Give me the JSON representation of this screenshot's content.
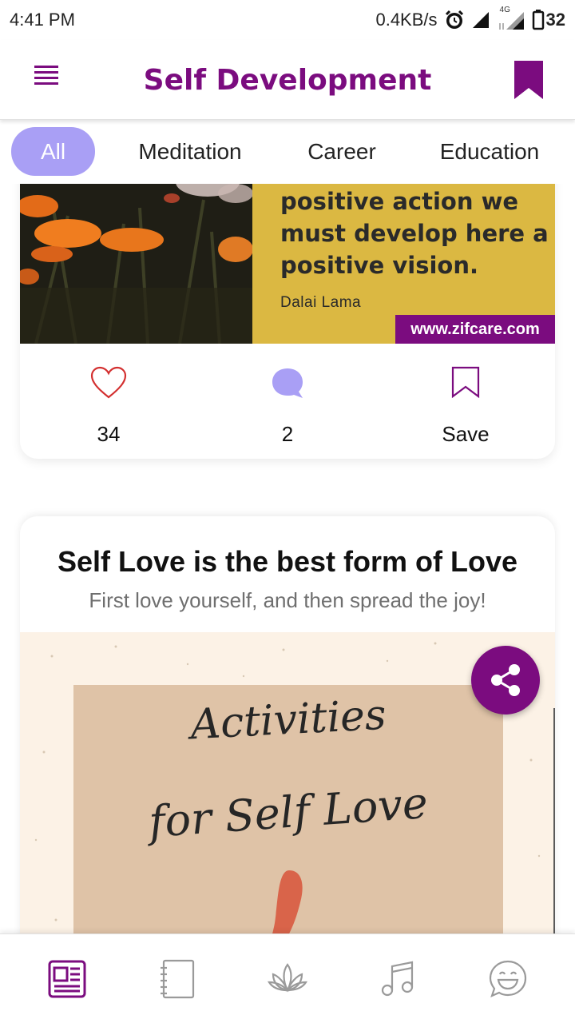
{
  "status_bar": {
    "time": "4:41 PM",
    "speed": "0.4KB/s",
    "network": "4G",
    "battery": "32",
    "icons": [
      "alarm-icon",
      "signal-icon",
      "signal-4g-icon",
      "battery-icon"
    ]
  },
  "header": {
    "title": "Self Development",
    "menu_icon": "menu-icon",
    "bookmark_icon": "bookmark-icon"
  },
  "tabs": [
    {
      "label": "All",
      "active": true
    },
    {
      "label": "Meditation",
      "active": false
    },
    {
      "label": "Career",
      "active": false
    },
    {
      "label": "Education",
      "active": false
    }
  ],
  "post1": {
    "quote": "positive action we must develop here a positive vision.",
    "author": "Dalai Lama",
    "site": "www.zifcare.com",
    "likes": "34",
    "comments": "2",
    "save_label": "Save"
  },
  "post2": {
    "title": "Self Love is the best form of Love",
    "subtitle": "First love yourself, and then spread the joy!",
    "image_line1": "Activities",
    "image_line2": "for Self Love"
  },
  "bottom_nav": [
    {
      "icon": "news-icon",
      "active": true
    },
    {
      "icon": "journal-icon",
      "active": false
    },
    {
      "icon": "lotus-icon",
      "active": false
    },
    {
      "icon": "music-icon",
      "active": false
    },
    {
      "icon": "chat-emoji-icon",
      "active": false
    }
  ],
  "colors": {
    "brand_purple": "#7b0c7f",
    "tab_active": "#a99ff5",
    "quote_yellow": "#dbb842",
    "heart_red": "#d32f2f"
  }
}
